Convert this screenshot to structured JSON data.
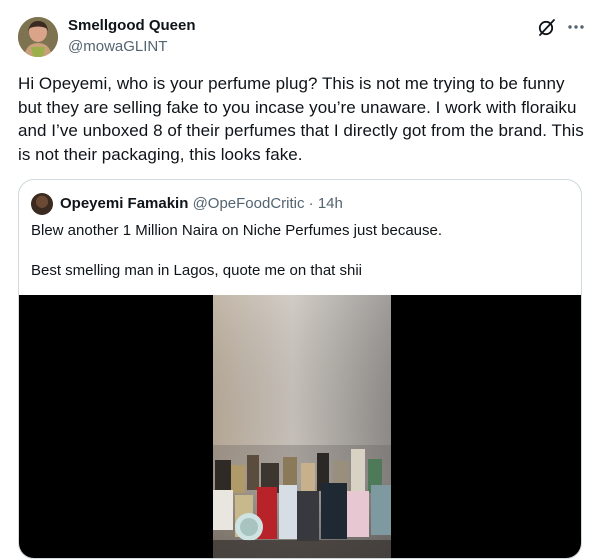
{
  "tweet": {
    "author_name": "Smellgood Queen",
    "author_handle": "@mowaGLINT",
    "text": "Hi Opeyemi, who is your perfume plug? This is not me trying to be funny but they are selling fake to you incase you’re unaware. I work with floraiku and I’ve unboxed 8 of their perfumes that I directly got from the brand. This is not their packaging, this looks fake."
  },
  "quote": {
    "author_name": "Opeyemi Famakin",
    "author_handle": "@OpeFoodCritic",
    "separator": " · ",
    "time": "14h",
    "line1": "Blew another 1 Million Naira on Niche Perfumes just because.",
    "line2": "Best smelling man in Lagos, quote me on that shii"
  },
  "icons": {
    "grok": "grok-icon",
    "more": "more-icon"
  }
}
